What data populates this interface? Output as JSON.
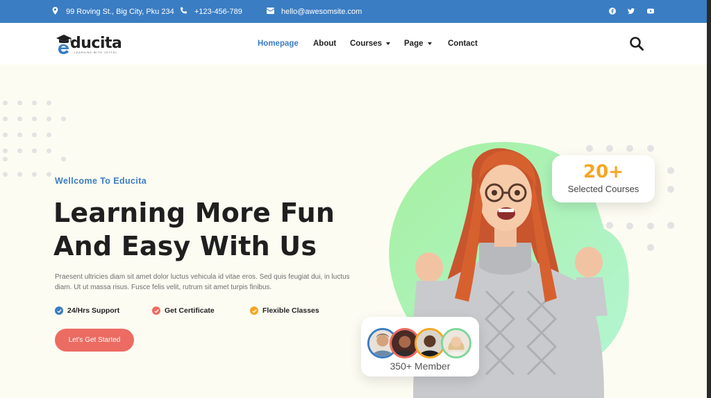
{
  "topbar": {
    "address": "99 Roving St., Big City, Pku 234",
    "phone": "+123-456-789",
    "email": "hello@awesomsite.com",
    "social_icons": [
      "facebook-icon",
      "twitter-icon",
      "youtube-icon"
    ]
  },
  "brand": {
    "name": "ducita",
    "initial": "e",
    "tagline": "LEARNING WITH JOYFUL"
  },
  "nav": {
    "items": [
      {
        "label": "Homepage",
        "active": true,
        "dropdown": false
      },
      {
        "label": "About",
        "active": false,
        "dropdown": false
      },
      {
        "label": "Courses",
        "active": false,
        "dropdown": true
      },
      {
        "label": "Page",
        "active": false,
        "dropdown": true
      },
      {
        "label": "Contact",
        "active": false,
        "dropdown": false
      }
    ],
    "search_icon": "search-icon"
  },
  "hero": {
    "eyebrow": "Wellcome To Educita",
    "headline_line1": "Learning More Fun",
    "headline_line2": "And Easy With Us",
    "description": "Praesent ultricies diam sit amet dolor luctus vehicula id vitae eros. Sed quis feugiat dui, in luctus diam. Ut ut massa risus. Fusce felis velit, rutrum sit amet turpis finibus.",
    "features": [
      {
        "label": "24/Hrs Support",
        "color": "#3a7dc3"
      },
      {
        "label": "Get Certificate",
        "color": "#ec6b62"
      },
      {
        "label": "Flexible Classes",
        "color": "#f5a623"
      }
    ],
    "cta_label": "Let's Get Started",
    "stat_number": "20+",
    "stat_label": "Selected Courses",
    "member_label": "350+ Member"
  },
  "colors": {
    "primary": "#3a7dc3",
    "accent_red": "#ec6b62",
    "accent_orange": "#f5a623",
    "blob_green": "#9ef0b0",
    "background": "#fdfcf2"
  }
}
